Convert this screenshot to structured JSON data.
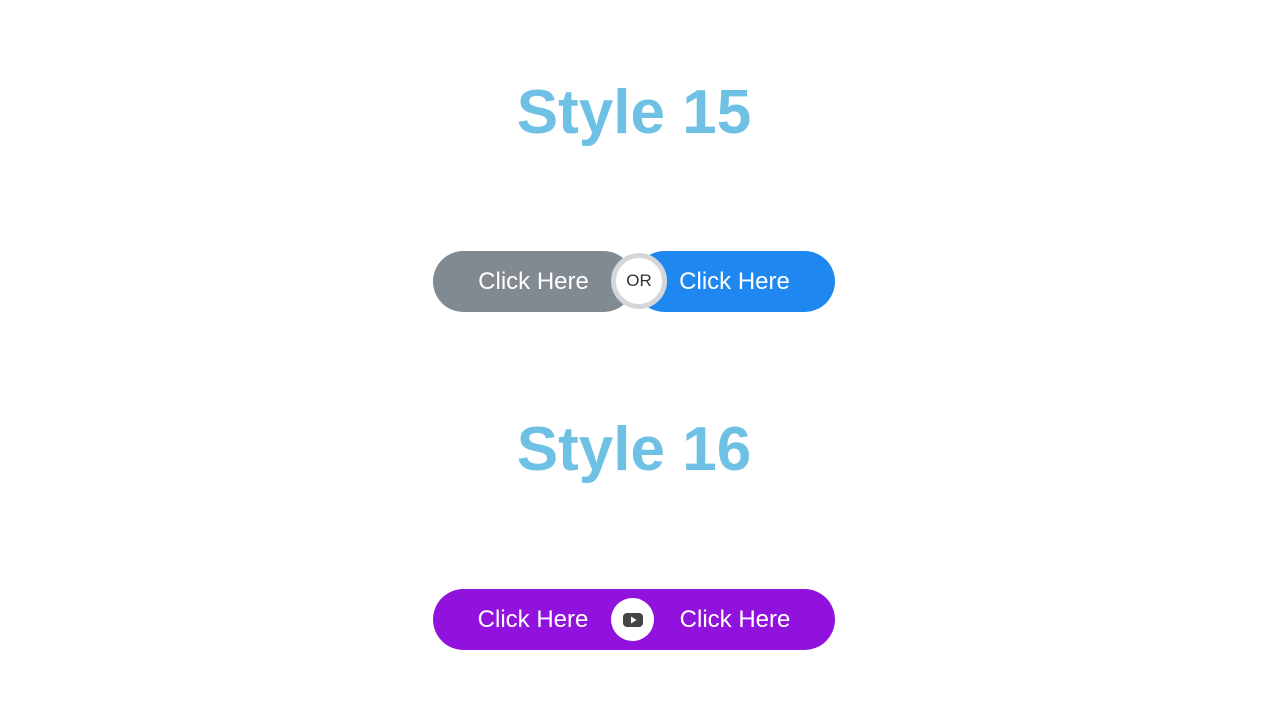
{
  "style15": {
    "title": "Style 15",
    "left_button_label": "Click Here",
    "divider_label": "OR",
    "right_button_label": "Click Here",
    "colors": {
      "left": "#818a91",
      "right": "#1e88f0"
    }
  },
  "style16": {
    "title": "Style 16",
    "left_button_label": "Click Here",
    "divider_icon": "youtube-play-icon",
    "right_button_label": "Click Here",
    "colors": {
      "background": "#9012dc"
    }
  },
  "colors": {
    "title": "#6ec1e4"
  }
}
